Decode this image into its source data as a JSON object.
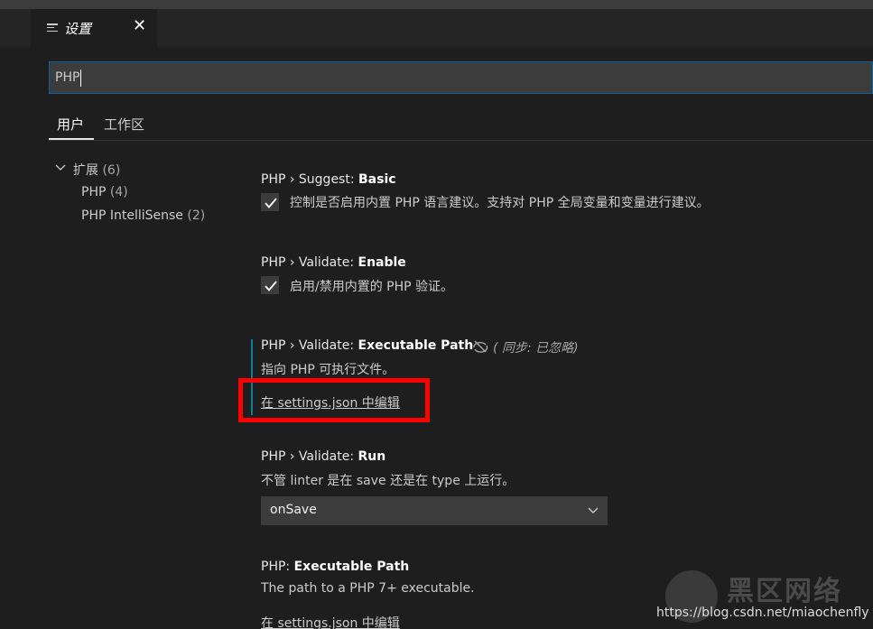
{
  "tab": {
    "title": "设置",
    "close": "✕"
  },
  "search": {
    "value": "PHP"
  },
  "scope_tabs": {
    "user": "用户",
    "workspace": "工作区"
  },
  "tree": {
    "extensions": {
      "label": "扩展",
      "count": "(6)"
    },
    "php": {
      "label": "PHP",
      "count": "(4)"
    },
    "intellisense": {
      "label": "PHP IntelliSense",
      "count": "(2)"
    }
  },
  "settings": {
    "suggest": {
      "prefix": "PHP › Suggest: ",
      "name": "Basic",
      "label": "控制是否启用内置 PHP 语言建议。支持对 PHP 全局变量和变量进行建议。"
    },
    "validate_enable": {
      "prefix": "PHP › Validate: ",
      "name": "Enable",
      "label": "启用/禁用内置的 PHP 验证。"
    },
    "validate_path": {
      "prefix": "PHP › Validate: ",
      "name": "Executable Path",
      "sync": "(  同步: 已忽略)",
      "desc": "指向 PHP 可执行文件。",
      "link": "在 settings.json 中编辑"
    },
    "validate_run": {
      "prefix": "PHP › Validate: ",
      "name": "Run",
      "desc": "不管 linter 是在 save 还是在 type 上运行。",
      "value": "onSave"
    },
    "executable_path": {
      "prefix": "PHP: ",
      "name": "Executable Path",
      "desc": "The path to a PHP 7+ executable.",
      "link": "在 settings.json 中编辑"
    }
  },
  "watermark": {
    "title": "黑区网络",
    "url": "https://blog.csdn.net/miaochenfly"
  }
}
